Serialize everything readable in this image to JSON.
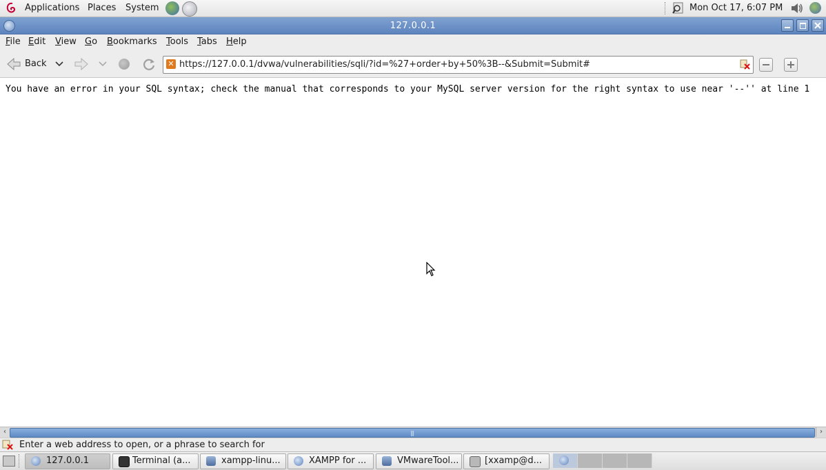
{
  "top_panel": {
    "menus": [
      "Applications",
      "Places",
      "System"
    ],
    "clock": "Mon Oct 17,  6:07 PM"
  },
  "window": {
    "title": "127.0.0.1"
  },
  "menubar": {
    "items": [
      "File",
      "Edit",
      "View",
      "Go",
      "Bookmarks",
      "Tools",
      "Tabs",
      "Help"
    ]
  },
  "navbar": {
    "back_label": "Back",
    "url": "https://127.0.0.1/dvwa/vulnerabilities/sqli/?id=%27+order+by+50%3B--&Submit=Submit#"
  },
  "content": {
    "error_text": "You have an error in your SQL syntax; check the manual that corresponds to your MySQL server version for the right syntax to use near '--'' at line 1"
  },
  "statusbar": {
    "text": "Enter a web address to open, or a phrase to search for"
  },
  "taskbar": {
    "tasks": [
      "127.0.0.1",
      "Terminal (a...",
      "xampp-linu...",
      "XAMPP for ...",
      "VMwareTool...",
      "[xxamp@d..."
    ]
  },
  "colors": {
    "titlebar": "#6a8ec6",
    "content_bg": "#ffffff",
    "panel_bg": "#ededed"
  }
}
